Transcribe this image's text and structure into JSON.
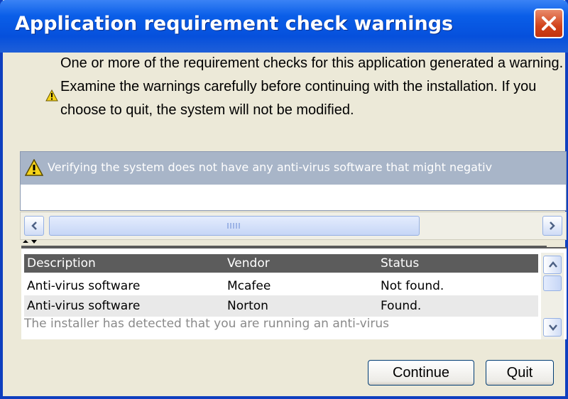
{
  "window": {
    "title": "Application requirement check warnings"
  },
  "message": {
    "text": "One or more of the requirement checks for this application generated a warning. Examine the warnings carefully before continuing with the installation. If you choose to quit, the system will not be modified.",
    "icon": "warning-icon"
  },
  "warnings": {
    "selected_item": "Verifying the system does not have any anti-virus software that might negativ",
    "icon": "warning-icon"
  },
  "details": {
    "columns": [
      "Description",
      "Vendor",
      "Status"
    ],
    "rows": [
      [
        "Anti-virus software",
        "Mcafee",
        "Not found."
      ],
      [
        "Anti-virus software",
        "Norton",
        "Found."
      ]
    ],
    "note": "The installer has detected that you are running an anti-virus"
  },
  "buttons": {
    "continue_label": "Continue",
    "quit_label": "Quit"
  },
  "colors": {
    "titlebar": "#0650dc",
    "close_button": "#d2431b",
    "selected_row": "#a8b5c8",
    "table_header": "#5c5c5c"
  }
}
